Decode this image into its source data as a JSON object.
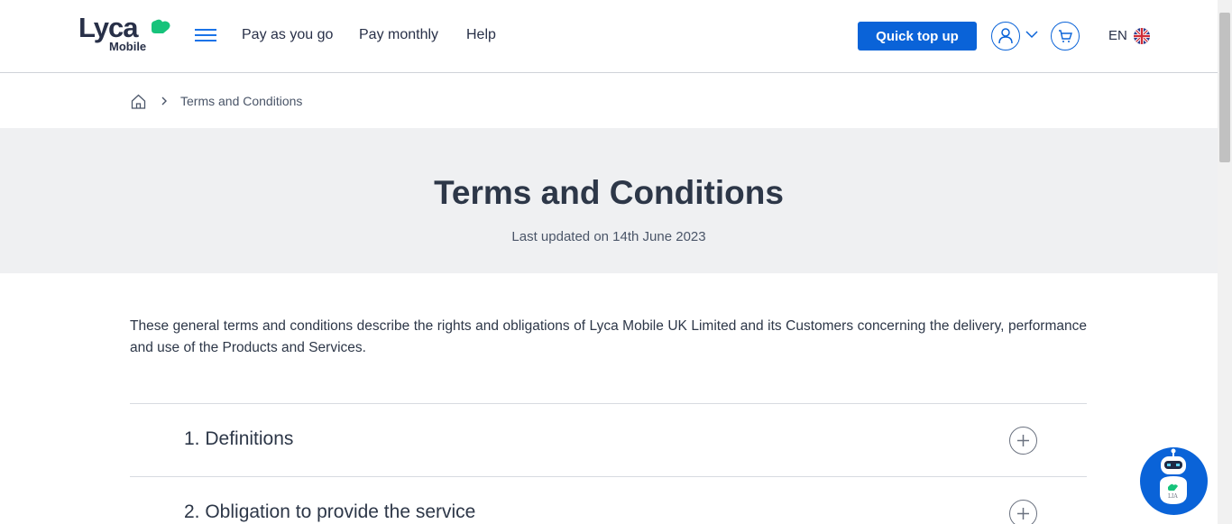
{
  "header": {
    "logo_text": "Lyca",
    "logo_subtext": "Mobile",
    "nav": [
      "Pay as you go",
      "Pay monthly",
      "Help"
    ],
    "quick_top_up": "Quick top up",
    "language": "EN"
  },
  "icons": {
    "menu": "hamburger-icon",
    "account": "user-icon",
    "cart": "cart-icon",
    "flag": "uk-flag-icon",
    "home": "home-icon"
  },
  "colors": {
    "brand_blue": "#0a63d8",
    "brand_green": "#17c37b",
    "text_dark": "#2d3748",
    "hero_bg": "#eff0f2"
  },
  "breadcrumb": {
    "current": "Terms and Conditions"
  },
  "hero": {
    "title": "Terms and Conditions",
    "updated": "Last updated on 14th June 2023"
  },
  "intro": "These general terms and conditions describe the rights and obligations of Lyca Mobile UK Limited and its Customers concerning the delivery, performance and use of the Products and Services.",
  "sections": [
    {
      "title": "1. Definitions"
    },
    {
      "title": "2. Obligation to provide the service"
    }
  ],
  "chatbot": {
    "label": "LIA"
  }
}
